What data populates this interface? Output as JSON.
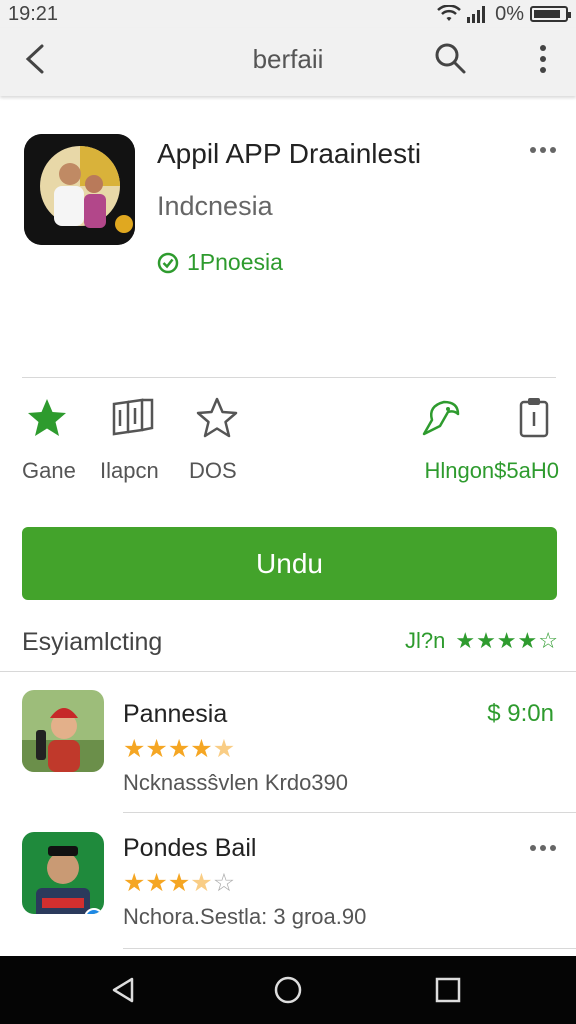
{
  "status_bar": {
    "time": "19:21",
    "battery_text": "0%"
  },
  "app_bar": {
    "title": "berfaii"
  },
  "app": {
    "title": "Appil APP Draainlesti",
    "subtitle": "Indcnesia",
    "verified_label": "1Pnoesia"
  },
  "stats": [
    {
      "label": "Gane",
      "icon": "star-filled-icon"
    },
    {
      "label": "Ilapcn",
      "icon": "book-icon"
    },
    {
      "label": "DOS",
      "icon": "star-outline-icon"
    },
    {
      "label": "Hlngon$5aH0",
      "icon": "bird-icon"
    }
  ],
  "install_label": "Undu",
  "section": {
    "label": "Esyiamlcting",
    "rating_text": "Jl?n",
    "rating": 4
  },
  "list": [
    {
      "title": "Pannesia",
      "price": "$ 9:0n",
      "rating": 4.5,
      "desc": "Ncknassŝvlen Krdo390"
    },
    {
      "title": "Pondes Bail",
      "rating": 3.5,
      "desc": "Nchora.Sestla: 3 groa.90"
    }
  ],
  "colors": {
    "accent": "#43a32b",
    "accent_text": "#2e9b2e",
    "star_orange": "#f5a623"
  }
}
